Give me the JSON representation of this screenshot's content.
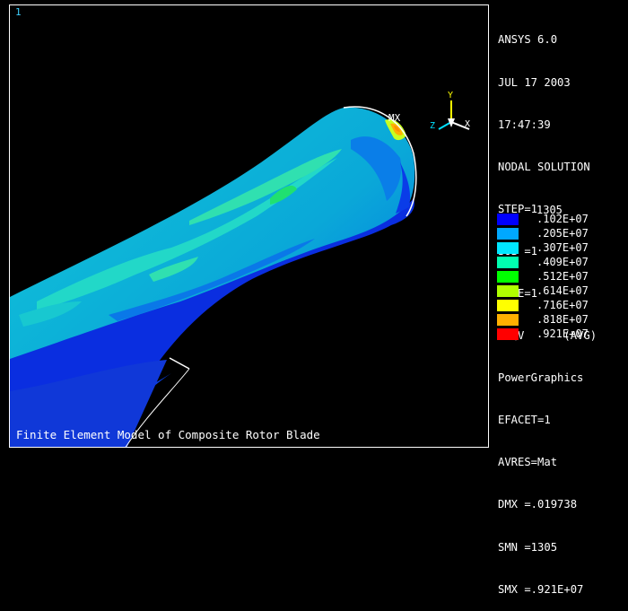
{
  "viewport": {
    "window_number": "1",
    "caption": "Finite Element Model of Composite Rotor Blade",
    "max_marker": "MX",
    "triad": {
      "y": "Y",
      "z": "Z",
      "x": "X"
    }
  },
  "info_lines": [
    "ANSYS 6.0",
    "JUL 17 2003",
    "17:47:39",
    "NODAL SOLUTION",
    "STEP=1",
    "SUB =1",
    "TIME=1",
    "SEQV      (AVG)",
    "PowerGraphics",
    "EFACET=1",
    "AVRES=Mat",
    "DMX =.019738",
    "SMN =1305",
    "SMX =.921E+07"
  ],
  "legend": {
    "min_label": "1305",
    "entries": [
      {
        "label": ".102E+07",
        "color": "#0000ff"
      },
      {
        "label": ".205E+07",
        "color": "#00a8ff"
      },
      {
        "label": ".307E+07",
        "color": "#00e6ff"
      },
      {
        "label": ".409E+07",
        "color": "#00ffb0"
      },
      {
        "label": ".512E+07",
        "color": "#00ff00"
      },
      {
        "label": ".614E+07",
        "color": "#b0ff00"
      },
      {
        "label": ".716E+07",
        "color": "#ffff00"
      },
      {
        "label": ".818E+07",
        "color": "#ffb000"
      },
      {
        "label": ".921E+07",
        "color": "#ff0000"
      }
    ]
  }
}
